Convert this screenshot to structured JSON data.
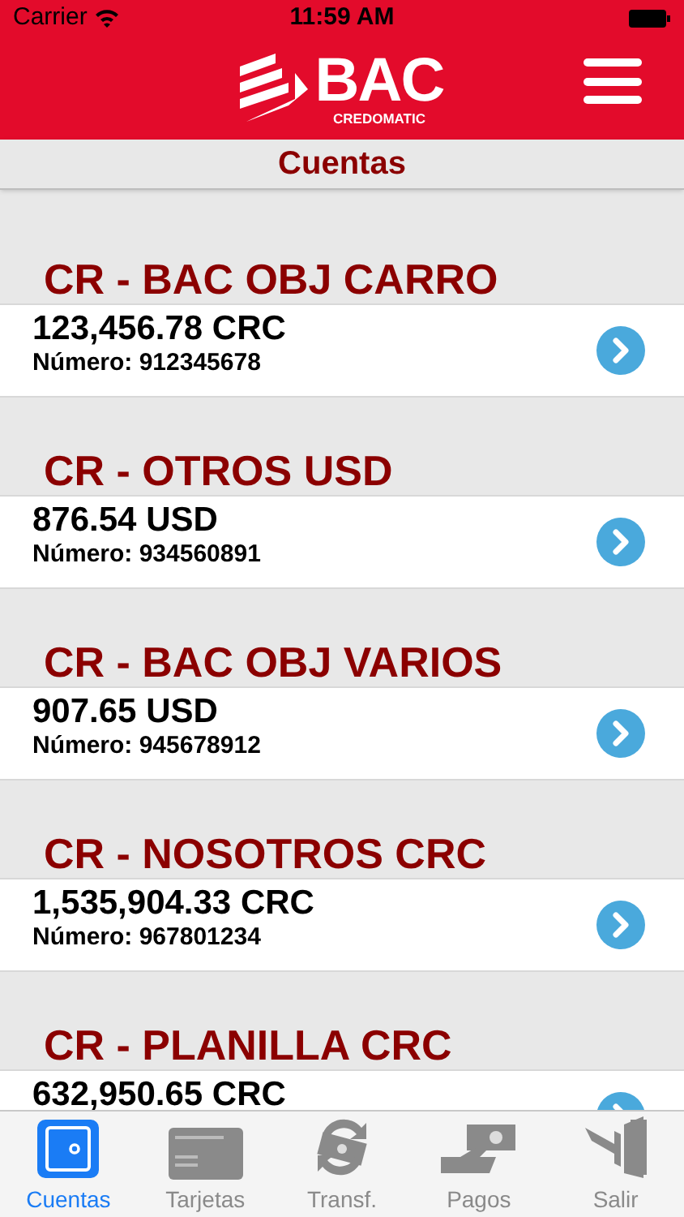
{
  "status_bar": {
    "carrier": "Carrier",
    "time": "11:59 AM"
  },
  "header": {
    "brand": "BAC",
    "brand_sub": "CREDOMATIC"
  },
  "page_title": "Cuentas",
  "accounts": [
    {
      "name": "CR - BAC OBJ CARRO",
      "balance": "123,456.78 CRC",
      "number": "Número: 912345678"
    },
    {
      "name": "CR - OTROS USD",
      "balance": "876.54 USD",
      "number": "Número: 934560891"
    },
    {
      "name": "CR - BAC OBJ VARIOS",
      "balance": "907.65 USD",
      "number": "Número: 945678912"
    },
    {
      "name": "CR - NOSOTROS CRC",
      "balance": "1,535,904.33 CRC",
      "number": "Número: 967801234"
    },
    {
      "name": "CR - PLANILLA CRC",
      "balance": "632,950.65 CRC"
    }
  ],
  "tabs": [
    {
      "kind": "safe",
      "label": "Cuentas",
      "selected": true
    },
    {
      "kind": "card",
      "label": "Tarjetas",
      "selected": false
    },
    {
      "kind": "transfer",
      "label": "Transf.",
      "selected": false
    },
    {
      "kind": "pay",
      "label": "Pagos",
      "selected": false
    },
    {
      "kind": "exit",
      "label": "Salir",
      "selected": false
    }
  ]
}
